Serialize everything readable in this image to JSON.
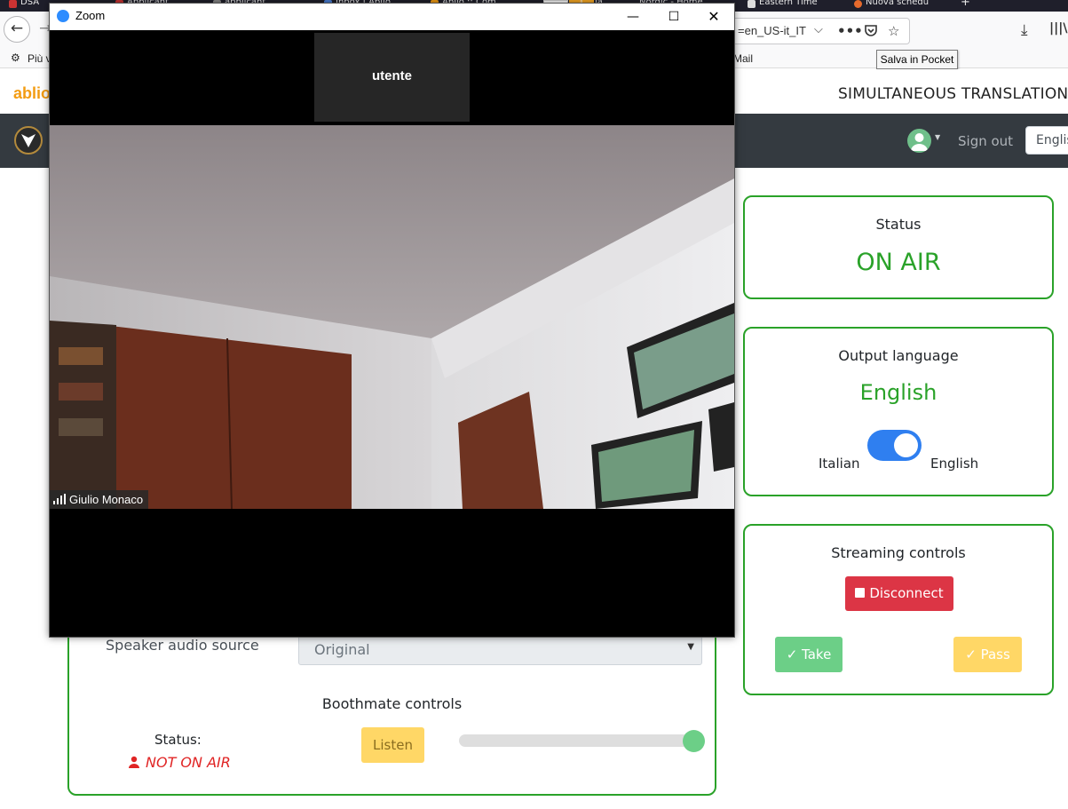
{
  "browser": {
    "tabs": [
      {
        "label": "DSA"
      },
      {
        "label": "Applicant"
      },
      {
        "label": "applicant"
      },
      {
        "label": "Inbox | Ablio"
      },
      {
        "label": "Ablio :: Com"
      },
      {
        "label": "ia"
      },
      {
        "label": "Nordic - Home"
      },
      {
        "label": "Eastern Time"
      },
      {
        "label": "Nuova schedu"
      }
    ],
    "url_fragment": "=en_US-it_IT",
    "bookmarks_item": "Più v",
    "bookmarks_mail": "Mail",
    "tooltip": "Salva in Pocket"
  },
  "app": {
    "brand": "ablio",
    "system_title": "SIMULTANEOUS TRANSLATION SYS",
    "sign_out": "Sign out",
    "language_select": "Englis"
  },
  "status_card": {
    "title": "Status",
    "value": "ON AIR"
  },
  "output_language_card": {
    "title": "Output language",
    "value": "English",
    "toggle_left": "Italian",
    "toggle_right": "English",
    "toggle_on": true
  },
  "streaming_card": {
    "title": "Streaming controls",
    "disconnect": "Disconnect",
    "take": "Take",
    "pass": "Pass"
  },
  "boothmate_card": {
    "speaker_audio_label": "Speaker audio source",
    "speaker_audio_value": "Original",
    "title": "Boothmate controls",
    "status_label": "Status:",
    "status_value": "NOT ON AIR",
    "listen": "Listen",
    "volume_level": 1.0
  },
  "zoom": {
    "window_title": "Zoom",
    "thumbnail_name": "utente",
    "participant_name": "Giulio Monaco"
  },
  "colors": {
    "accent_green": "#2aa229",
    "danger": "#dc3545",
    "success": "#6ccf87",
    "warning": "#ffd766",
    "toggle_blue": "#2f7ff0"
  }
}
